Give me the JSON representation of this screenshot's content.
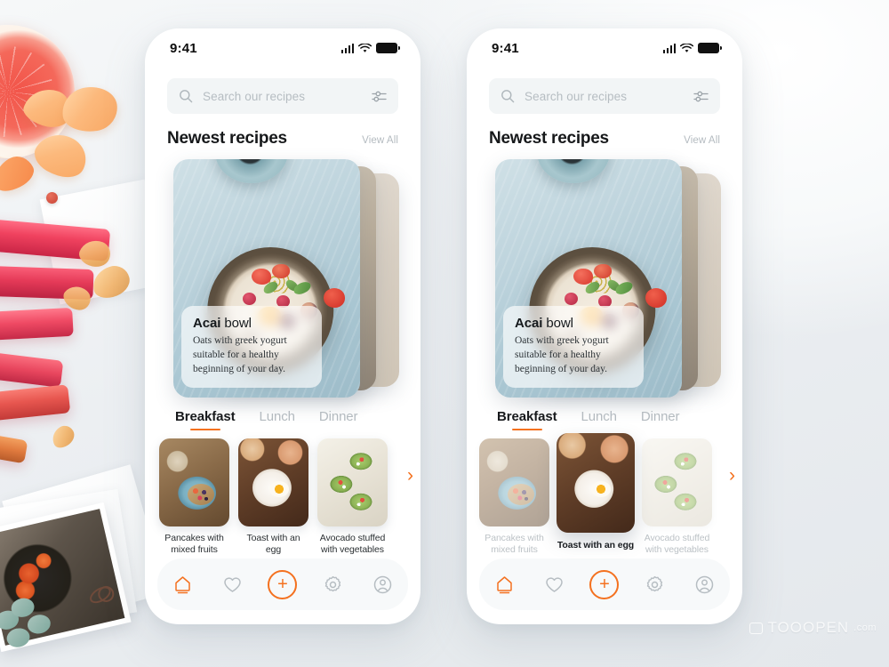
{
  "background": {
    "watermark_text": "TOOOPEN",
    "watermark_suffix": ".com",
    "accent_color": "#f4711f",
    "stage_color": "#eef1f3"
  },
  "phones": [
    {
      "id": "phone-one",
      "status": {
        "time": "9:41",
        "signal_icon": "signal-bars-icon",
        "wifi_icon": "wifi-icon",
        "battery_icon": "battery-icon"
      },
      "search": {
        "placeholder": "Search our recipes",
        "search_icon": "search-icon",
        "filter_icon": "filter-sliders-icon"
      },
      "section": {
        "title": "Newest recipes",
        "view_all": "View All"
      },
      "hero": {
        "title_bold": "Acai",
        "title_light": " bowl",
        "description": "Oats with greek yogurt suitable for a healthy beginning of your day."
      },
      "tabs": [
        {
          "label": "Breakfast",
          "active": true
        },
        {
          "label": "Lunch",
          "active": false
        },
        {
          "label": "Dinner",
          "active": false
        }
      ],
      "thumbnails": [
        {
          "label": "Pancakes with mixed fruits",
          "state": "normal"
        },
        {
          "label": "Toast with an egg",
          "state": "normal"
        },
        {
          "label": "Avocado stuffed with vegetables",
          "state": "normal"
        }
      ],
      "next_arrow": "›",
      "nav": [
        {
          "name": "home-icon",
          "label": "Home",
          "active": true
        },
        {
          "name": "heart-icon",
          "label": "Favorites",
          "active": false
        },
        {
          "name": "plus-circle-icon",
          "label": "Add",
          "active": true
        },
        {
          "name": "gear-icon",
          "label": "Settings",
          "active": false
        },
        {
          "name": "profile-icon",
          "label": "Profile",
          "active": false
        }
      ],
      "plus_glyph": "+"
    },
    {
      "id": "phone-two",
      "status": {
        "time": "9:41",
        "signal_icon": "signal-bars-icon",
        "wifi_icon": "wifi-icon",
        "battery_icon": "battery-icon"
      },
      "search": {
        "placeholder": "Search our recipes",
        "search_icon": "search-icon",
        "filter_icon": "filter-sliders-icon"
      },
      "section": {
        "title": "Newest recipes",
        "view_all": "View All"
      },
      "hero": {
        "title_bold": "Acai",
        "title_light": " bowl",
        "description": "Oats with greek yogurt suitable for a healthy beginning of your day."
      },
      "tabs": [
        {
          "label": "Breakfast",
          "active": true
        },
        {
          "label": "Lunch",
          "active": false
        },
        {
          "label": "Dinner",
          "active": false
        }
      ],
      "thumbnails": [
        {
          "label": "Pancakes with mixed fruits",
          "state": "dimmed"
        },
        {
          "label": "Toast with an egg",
          "state": "selected"
        },
        {
          "label": "Avocado stuffed with vegetables",
          "state": "dimmed"
        }
      ],
      "next_arrow": "›",
      "nav": [
        {
          "name": "home-icon",
          "label": "Home",
          "active": true
        },
        {
          "name": "heart-icon",
          "label": "Favorites",
          "active": false
        },
        {
          "name": "plus-circle-icon",
          "label": "Add",
          "active": true
        },
        {
          "name": "gear-icon",
          "label": "Settings",
          "active": false
        },
        {
          "name": "profile-icon",
          "label": "Profile",
          "active": false
        }
      ],
      "plus_glyph": "+"
    }
  ]
}
